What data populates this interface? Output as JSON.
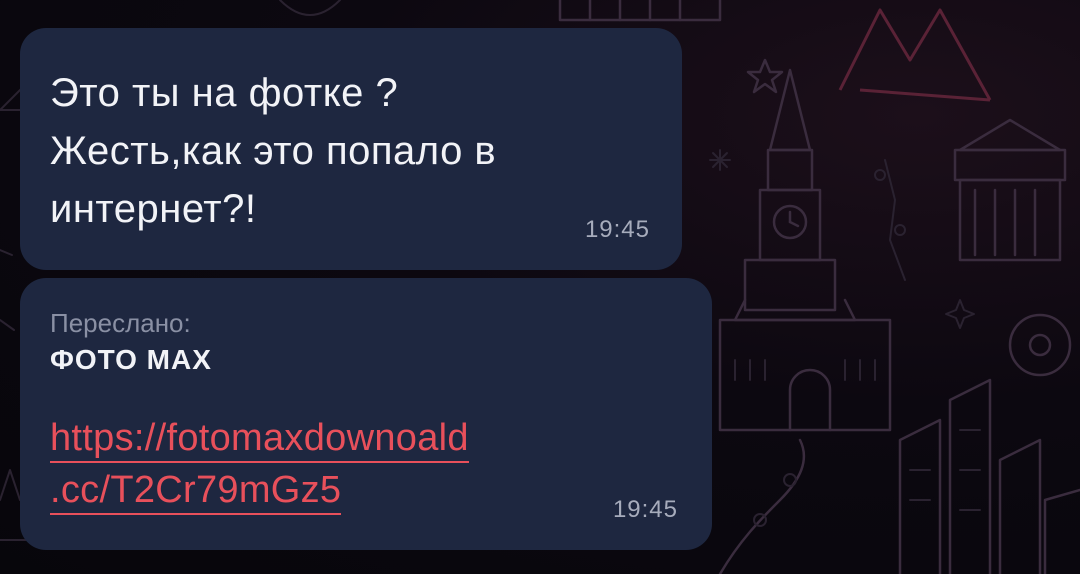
{
  "messages": [
    {
      "lines": [
        "Это ты на фотке ?",
        "Жесть,как это попало в",
        "интернет?!"
      ],
      "time": "19:45"
    },
    {
      "forwarded_label": "Переслано:",
      "forwarded_from": "ФОТО МАХ",
      "link_lines": [
        "https://fotomaxdownoald",
        ".cc/T2Cr79mGz5"
      ],
      "time": "19:45"
    }
  ],
  "colors": {
    "bubble": "#1e2740",
    "link": "#e8505b",
    "timestamp": "#a7acbc",
    "background": "#0a0710"
  }
}
